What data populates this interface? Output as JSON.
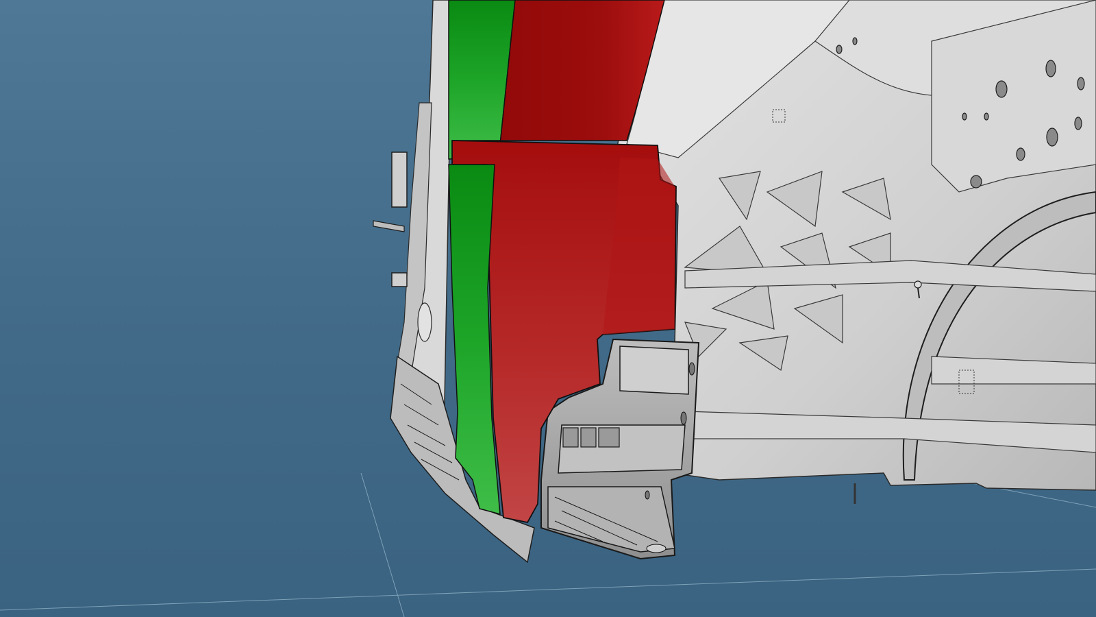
{
  "viewport": {
    "background_top": "#4e7895",
    "background_bottom": "#3b6482",
    "grid_line_color": "#8fb0c6"
  },
  "model": {
    "base_body_color": "#d3d3d3",
    "base_body_shade": "#a9a9a9",
    "edge_color": "#1e1e1e",
    "highlighted_parts": [
      {
        "name": "upper-red-panel",
        "color": "#9b0c0c"
      },
      {
        "name": "lower-red-panel",
        "color": "#c32424"
      },
      {
        "name": "green-strip",
        "color": "#22a92d"
      }
    ]
  }
}
